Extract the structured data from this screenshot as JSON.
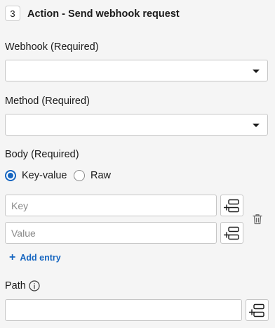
{
  "step": {
    "number": "3",
    "title": "Action - Send webhook request"
  },
  "webhook": {
    "label": "Webhook (Required)",
    "value": ""
  },
  "method": {
    "label": "Method (Required)",
    "value": ""
  },
  "body": {
    "label": "Body (Required)",
    "options": [
      {
        "label": "Key-value",
        "selected": true
      },
      {
        "label": "Raw",
        "selected": false
      }
    ],
    "entries": [
      {
        "key_placeholder": "Key",
        "value_placeholder": "Value",
        "key": "",
        "value": ""
      }
    ],
    "add_entry_label": "Add entry"
  },
  "path": {
    "label": "Path",
    "value": ""
  },
  "colors": {
    "accent": "#1565c0",
    "background": "#f5f5f5",
    "border": "#c6c6c6"
  },
  "icons": {
    "dropdown": "chevron-down-icon",
    "map_field": "insert-variable-icon",
    "delete": "trash-icon",
    "add": "plus-icon",
    "info": "info-icon"
  }
}
